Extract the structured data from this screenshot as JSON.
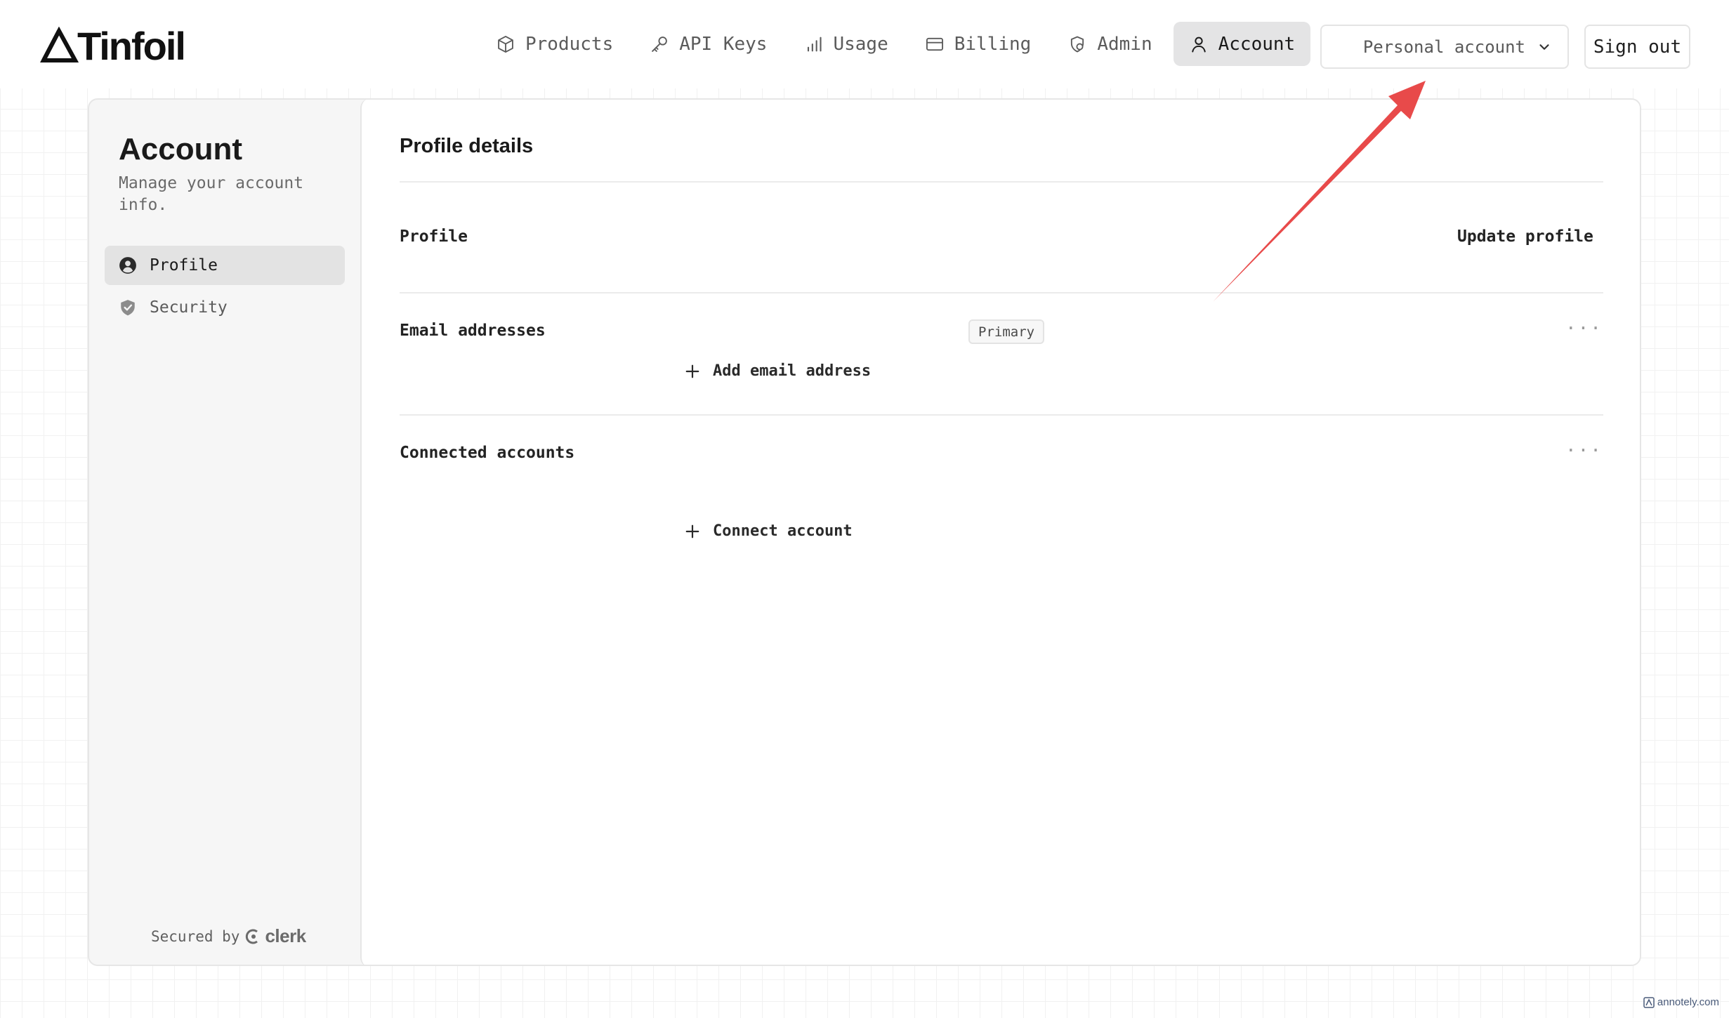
{
  "brand": {
    "name": "Tinfoil"
  },
  "nav": {
    "items": [
      {
        "label": "Products",
        "icon": "box-icon",
        "active": false
      },
      {
        "label": "API Keys",
        "icon": "key-icon",
        "active": false
      },
      {
        "label": "Usage",
        "icon": "bar-chart-icon",
        "active": false
      },
      {
        "label": "Billing",
        "icon": "credit-card-icon",
        "active": false
      },
      {
        "label": "Admin",
        "icon": "shield-icon",
        "active": false
      },
      {
        "label": "Account",
        "icon": "user-icon",
        "active": true
      }
    ]
  },
  "header": {
    "account_select": {
      "value": "Personal account",
      "icon": "chevron-down-icon"
    },
    "sign_out_label": "Sign out"
  },
  "sidebar": {
    "title": "Account",
    "subtitle": "Manage your account info.",
    "items": [
      {
        "label": "Profile",
        "icon": "user-circle-icon",
        "active": true
      },
      {
        "label": "Security",
        "icon": "shield-check-icon",
        "active": false
      }
    ],
    "footer": {
      "secured_by": "Secured by",
      "provider": "clerk"
    }
  },
  "main": {
    "title": "Profile details",
    "profile": {
      "label": "Profile",
      "action": "Update profile"
    },
    "email": {
      "label": "Email addresses",
      "badge": "Primary",
      "add_label": "Add email address",
      "menu": "···"
    },
    "connected": {
      "label": "Connected accounts",
      "add_label": "Connect account",
      "menu": "···"
    }
  },
  "annotation": {
    "arrow_color": "#e84a4a",
    "watermark": "annotely.com"
  }
}
